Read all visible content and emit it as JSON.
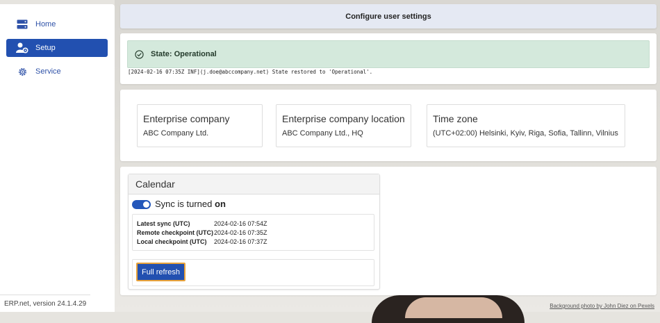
{
  "sidebar": {
    "items": [
      {
        "label": "Home",
        "icon": "server-icon"
      },
      {
        "label": "Setup",
        "icon": "user-gear-icon"
      },
      {
        "label": "Service",
        "icon": "gear-icon"
      }
    ],
    "version": "ERP.net, version 24.1.4.29"
  },
  "header": {
    "title": "Configure user settings"
  },
  "state": {
    "text": "State: Operational",
    "log": "[2024-02-16 07:35Z INF](j.doe@abccompany.net) State restored to 'Operational'."
  },
  "info_cards": [
    {
      "title": "Enterprise company",
      "value": "ABC Company Ltd."
    },
    {
      "title": "Enterprise company location",
      "value": "ABC Company Ltd., HQ"
    },
    {
      "title": "Time zone",
      "value": "(UTC+02:00) Helsinki, Kyiv, Riga, Sofia, Tallinn, Vilnius"
    }
  ],
  "calendar": {
    "title": "Calendar",
    "sync_prefix": "Sync is turned",
    "sync_state": "on",
    "rows": [
      {
        "label": "Latest sync (UTC)",
        "value": "2024-02-16 07:54Z"
      },
      {
        "label": "Remote checkpoint (UTC)",
        "value": "2024-02-16 07:35Z"
      },
      {
        "label": "Local checkpoint (UTC)",
        "value": "2024-02-16 07:37Z"
      }
    ],
    "button_label": "Full refresh"
  },
  "credit": "Background photo by John Diez on Pexels",
  "colors": {
    "accent": "#2250b0",
    "state_bg": "#d4e9dc",
    "focus": "#e8a23a"
  }
}
